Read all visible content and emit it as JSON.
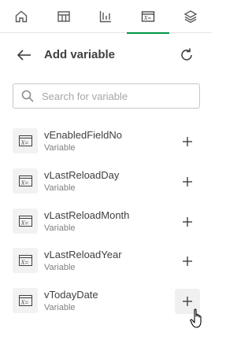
{
  "tabs": [
    {
      "icon": "home-icon",
      "active": false
    },
    {
      "icon": "table-icon",
      "active": false
    },
    {
      "icon": "chart-icon",
      "active": false
    },
    {
      "icon": "variable-icon",
      "active": true
    },
    {
      "icon": "layers-icon",
      "active": false
    }
  ],
  "colors": {
    "accent": "#009845",
    "text": "#404040",
    "muted": "#808080",
    "icon_bg": "#f2f2f2"
  },
  "header": {
    "title": "Add variable"
  },
  "search": {
    "placeholder": "Search for variable",
    "value": ""
  },
  "variables": [
    {
      "name": "vEnabledFieldNo",
      "type": "Variable"
    },
    {
      "name": "vLastReloadDay",
      "type": "Variable"
    },
    {
      "name": "vLastReloadMonth",
      "type": "Variable"
    },
    {
      "name": "vLastReloadYear",
      "type": "Variable"
    },
    {
      "name": "vTodayDate",
      "type": "Variable"
    }
  ]
}
